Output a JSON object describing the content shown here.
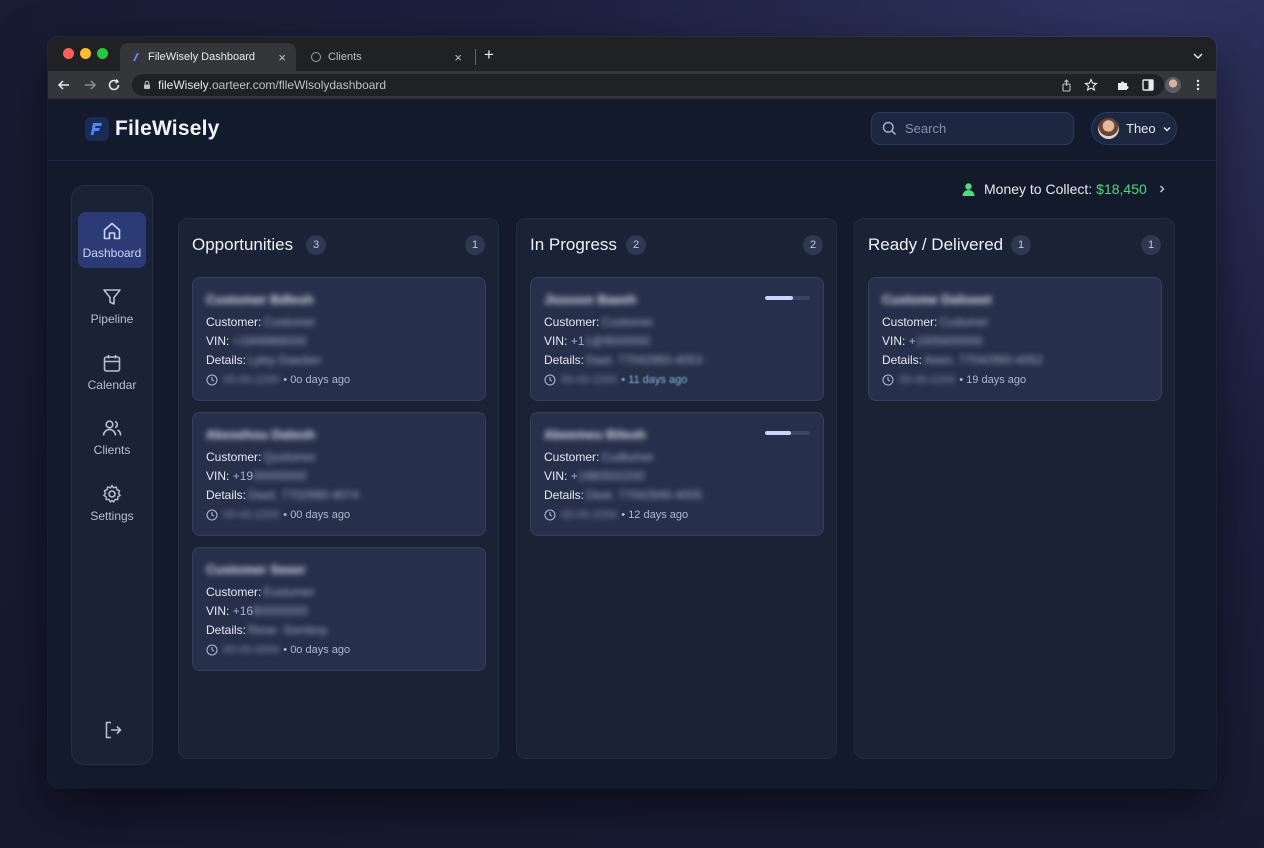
{
  "browser": {
    "tabs": [
      {
        "title": "FileWisely Dashboard",
        "close": "×"
      },
      {
        "title": "Clients",
        "close": "×"
      }
    ],
    "new_tab": "+",
    "url_host": "fileWisely",
    "url_rest": ".oarteer.com/flleWlsolydashboard"
  },
  "app": {
    "logo": "FileWisely",
    "search_placeholder": "Search",
    "user_name": "Theo"
  },
  "sidebar": {
    "items": [
      {
        "label": "Dashboard",
        "icon": "home-icon"
      },
      {
        "label": "Pipeline",
        "icon": "filter-icon"
      },
      {
        "label": "Calendar",
        "icon": "calendar-icon"
      },
      {
        "label": "Clients",
        "icon": "users-icon"
      },
      {
        "label": "Settings",
        "icon": "gear-icon"
      }
    ],
    "logout_icon": "logout-icon"
  },
  "money": {
    "label": "Money to Collect:",
    "amount": "$18,450",
    "color": "#4ade80"
  },
  "columns": [
    {
      "title": "Opportunities",
      "count": "3",
      "badge": "1",
      "cards": [
        {
          "title": "Customer Bdlesh",
          "customer_label": "Customer:",
          "customer": "Customer",
          "vin_label": "VIN:",
          "vin": "+1949966000",
          "details_label": "Details:",
          "details": "Lyley Daedan",
          "date": "00-00-2200",
          "ago": "• 0o days ago"
        },
        {
          "title": "Akesehou Daleoh",
          "customer_label": "Customer:",
          "customer": "Qustomer",
          "vin_label": "VIN:",
          "vin": "+19",
          "vin_blur": "00000000",
          "details_label": "Details:",
          "details": "Dwel, 7702990-4074",
          "date": "00-00-2200",
          "ago": "• 00 days ago"
        },
        {
          "title": "Customer Seeer",
          "customer_label": "Customer:",
          "customer": "Eustumer",
          "vin_label": "VIN:",
          "vin": "+16",
          "vin_blur": "B0000000",
          "details_label": "Details:",
          "details": "Rese- Somboy",
          "date": "00-00-0000",
          "ago": "• 0o days ago"
        }
      ]
    },
    {
      "title": "In Progress",
      "count": "2",
      "badge": "2",
      "cards": [
        {
          "title": "Jiosoon Baeeh",
          "customer_label": "Customer:",
          "customer": "Customer",
          "vin_label": "VIN:",
          "vin": "+1",
          "vin_blur": "1@9500000",
          "details_label": "Details:",
          "details": "Daet. 77042950-4053",
          "date": "00-00-2200",
          "ago": "• 11 days ago",
          "progress": 0.62
        },
        {
          "title": "Abeemeu Bileoh",
          "customer_label": "Customer:",
          "customer": "Cudtumer",
          "vin_label": "VIN:",
          "vin": "+",
          "vin_blur": "1980502200",
          "details_label": "Details:",
          "details": "Deet. 77042945-4005",
          "date": "00-00-2200",
          "ago": "• 12 days ago",
          "progress": 0.58
        }
      ]
    },
    {
      "title": "Ready / Delivered",
      "count": "1",
      "badge": "1",
      "cards": [
        {
          "title": "Custome Dalioeet",
          "customer_label": "Customer:",
          "customer": "Cudumer",
          "vin_label": "VIN:",
          "vin": "+",
          "vin_blur": "1005600000",
          "details_label": "Details:",
          "details": "Aeen. 77042950-4052",
          "date": "00-00-2200",
          "ago": "• 19 days ago"
        }
      ]
    }
  ]
}
